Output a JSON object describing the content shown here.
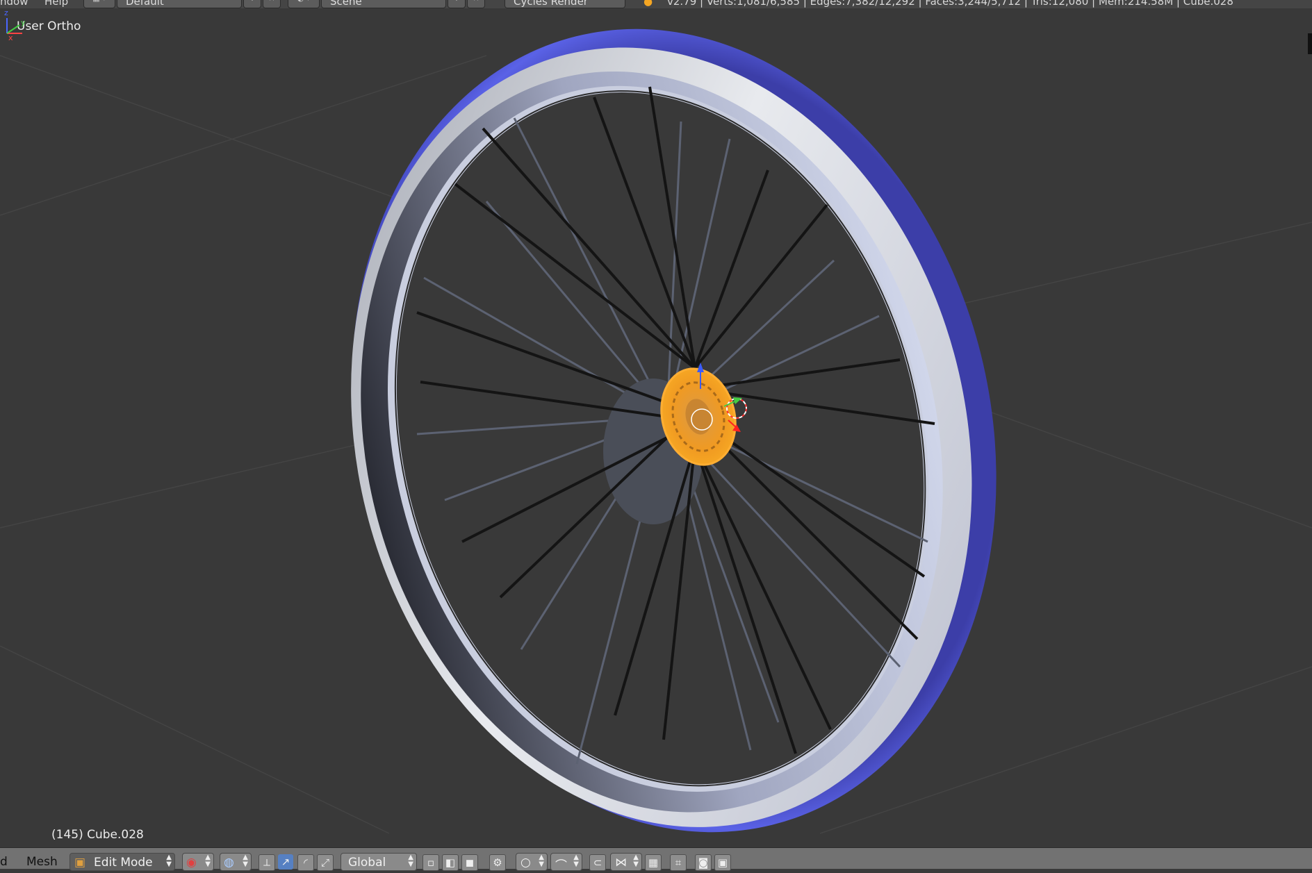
{
  "top_header": {
    "menu_window": "ndow",
    "menu_help": "Help",
    "screen_layout": "Default",
    "scene": "Scene",
    "render_engine": "Cycles Render",
    "stats": "v2.79 | Verts:1,081/6,585 | Edges:7,382/12,292 | Faces:3,244/5,712 | Tris:12,080 | Mem:214.58M | Cube.028"
  },
  "viewport": {
    "view_label": "User Ortho",
    "object_label": "(145) Cube.028",
    "colors": {
      "background": "#393939",
      "tire": "#4a50d0",
      "rim": "#c8ccd8",
      "spoke": "#1a1a1a",
      "hub_selected": "#f29a1e"
    },
    "gizmo_axes": [
      "x",
      "y",
      "z"
    ]
  },
  "bottom_header": {
    "menu_view_partial": "d",
    "menu_mesh": "Mesh",
    "mode": "Edit Mode",
    "viewport_shading": "solid-sphere-icon",
    "pivot": "pivot-icon",
    "transform_orientation": "Global",
    "icons": [
      "manipulator-icon",
      "translate-icon",
      "rotate-icon",
      "scale-icon",
      "vertex-select-icon",
      "edge-select-icon",
      "face-select-icon",
      "occlude-icon",
      "proportional-icon",
      "falloff-icon",
      "snap-icon",
      "snap-element-icon",
      "layers-icon",
      "uv-icon",
      "render-icon",
      "camera-icon"
    ]
  }
}
